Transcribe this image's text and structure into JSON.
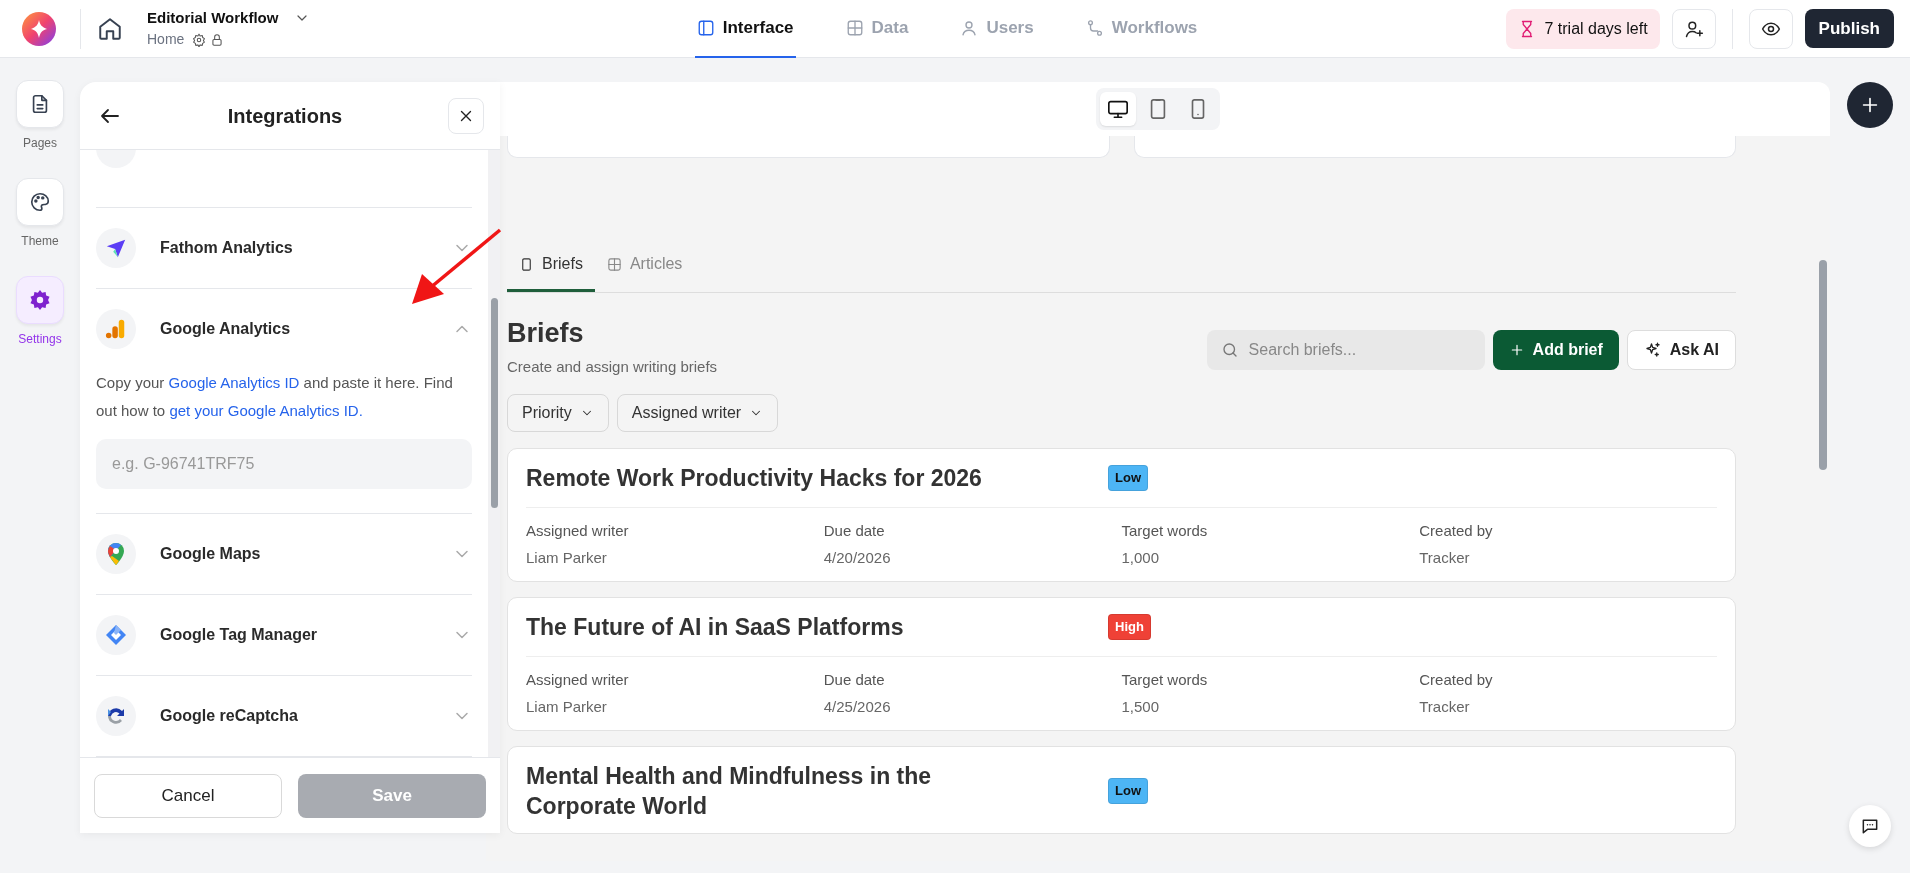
{
  "top_bar": {
    "app_title": "Editorial Workflow",
    "page": "Home",
    "nav": [
      {
        "label": "Interface",
        "selected": true
      },
      {
        "label": "Data",
        "selected": false
      },
      {
        "label": "Users",
        "selected": false
      },
      {
        "label": "Workflows",
        "selected": false
      }
    ],
    "trial_badge": "7 trial days left",
    "publish": "Publish"
  },
  "rail": [
    {
      "label": "Pages",
      "selected": false
    },
    {
      "label": "Theme",
      "selected": false
    },
    {
      "label": "Settings",
      "selected": true
    }
  ],
  "panel": {
    "title": "Integrations",
    "items": [
      {
        "name": "Fathom Analytics",
        "expanded": false
      },
      {
        "name": "Google Analytics",
        "expanded": true,
        "description": [
          {
            "kind": "text",
            "text": "Copy your "
          },
          {
            "kind": "link",
            "text": "Google Analytics ID"
          },
          {
            "kind": "text",
            "text": " and paste it here. Find out how to "
          },
          {
            "kind": "link",
            "text": "get your Google Analytics ID."
          }
        ],
        "placeholder": "e.g. G-96741TRF75"
      },
      {
        "name": "Google Maps",
        "expanded": false
      },
      {
        "name": "Google Tag Manager",
        "expanded": false
      },
      {
        "name": "Google reCaptcha",
        "expanded": false
      }
    ],
    "cancel": "Cancel",
    "save": {
      "label": "Save",
      "disabled": true
    }
  },
  "canvas": {
    "devices": [
      {
        "kind": "desktop",
        "selected": true
      },
      {
        "kind": "tablet",
        "selected": false
      },
      {
        "kind": "mobile",
        "selected": false
      }
    ],
    "tabs": [
      {
        "label": "Briefs",
        "selected": true
      },
      {
        "label": "Articles",
        "selected": false
      }
    ],
    "heading": "Briefs",
    "subtitle": "Create and assign writing briefs",
    "search": {
      "placeholder": "Search briefs..."
    },
    "add_button": "Add brief",
    "ai_button": "Ask AI",
    "filters": [
      "Priority",
      "Assigned writer"
    ],
    "briefs": [
      {
        "title": "Remote Work Productivity Hacks for 2026",
        "priority": {
          "label": "Low",
          "color": "#4db5f5"
        },
        "fields": [
          {
            "label": "Assigned writer",
            "value": "Liam Parker"
          },
          {
            "label": "Due date",
            "value": "4/20/2026"
          },
          {
            "label": "Target words",
            "value": "1,000"
          },
          {
            "label": "Created by",
            "value": "Tracker"
          }
        ]
      },
      {
        "title": "The Future of AI in SaaS Platforms",
        "priority": {
          "label": "High",
          "color": "#ef4136"
        },
        "fields": [
          {
            "label": "Assigned writer",
            "value": "Liam Parker"
          },
          {
            "label": "Due date",
            "value": "4/25/2026"
          },
          {
            "label": "Target words",
            "value": "1,500"
          },
          {
            "label": "Created by",
            "value": "Tracker"
          }
        ]
      },
      {
        "title": "Mental Health and Mindfulness in the Corporate World",
        "priority": {
          "label": "Low",
          "color": "#4db5f5"
        }
      }
    ]
  }
}
